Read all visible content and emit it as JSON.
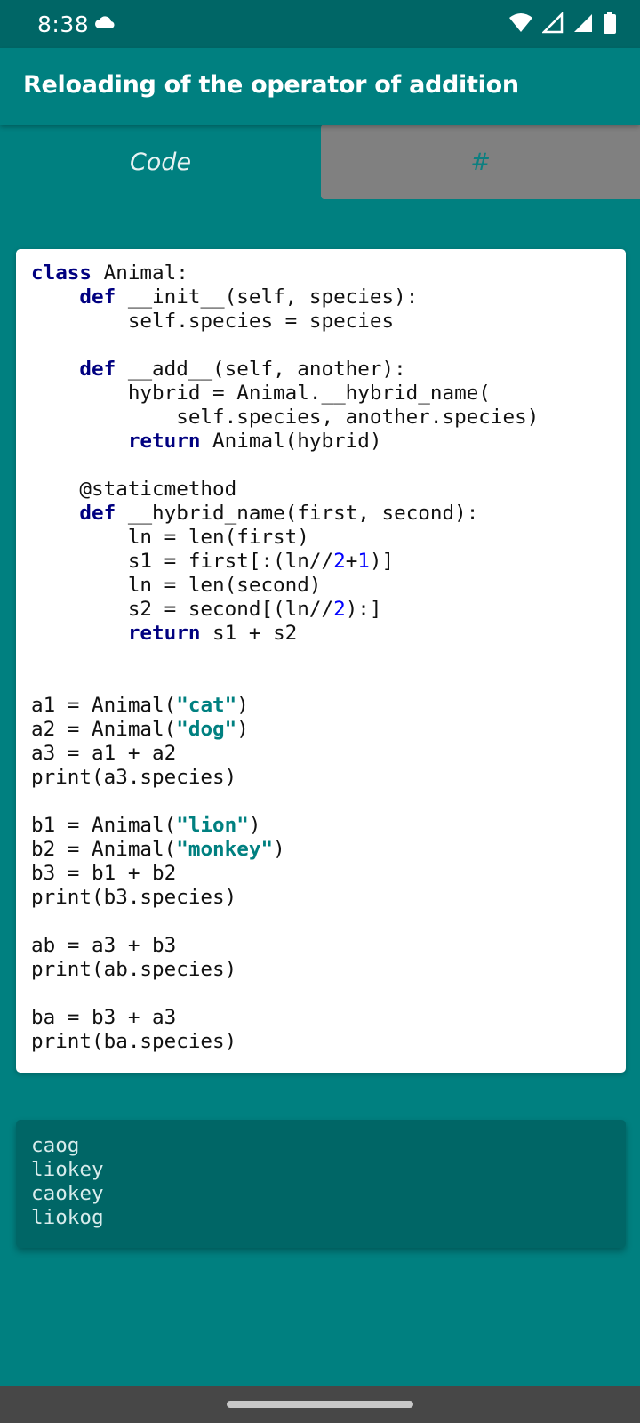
{
  "status_bar": {
    "time": "8:38",
    "icons": [
      "cloud-icon",
      "wifi-icon",
      "signal-icon",
      "signal-icon",
      "battery-icon"
    ]
  },
  "app_bar": {
    "title": "Reloading of the operator of addition"
  },
  "tabs": [
    {
      "label": "Code",
      "selected": true
    },
    {
      "label": "#",
      "selected": false
    }
  ],
  "code": {
    "lines": [
      [
        {
          "t": "class",
          "c": "kw"
        },
        {
          "t": " Animal:"
        }
      ],
      [
        {
          "t": "    "
        },
        {
          "t": "def",
          "c": "kw"
        },
        {
          "t": " __init__(self, species):"
        }
      ],
      [
        {
          "t": "        self.species = species"
        }
      ],
      [
        {
          "t": ""
        }
      ],
      [
        {
          "t": "    "
        },
        {
          "t": "def",
          "c": "kw"
        },
        {
          "t": " __add__(self, another):"
        }
      ],
      [
        {
          "t": "        hybrid = Animal.__hybrid_name("
        }
      ],
      [
        {
          "t": "            self.species, another.species)"
        }
      ],
      [
        {
          "t": "        "
        },
        {
          "t": "return",
          "c": "kw"
        },
        {
          "t": " Animal(hybrid)"
        }
      ],
      [
        {
          "t": ""
        }
      ],
      [
        {
          "t": "    @staticmethod"
        }
      ],
      [
        {
          "t": "    "
        },
        {
          "t": "def",
          "c": "kw"
        },
        {
          "t": " __hybrid_name(first, second):"
        }
      ],
      [
        {
          "t": "        ln = len(first)"
        }
      ],
      [
        {
          "t": "        s1 = first[:(ln//"
        },
        {
          "t": "2",
          "c": "num"
        },
        {
          "t": "+"
        },
        {
          "t": "1",
          "c": "num"
        },
        {
          "t": ")]"
        }
      ],
      [
        {
          "t": "        ln = len(second)"
        }
      ],
      [
        {
          "t": "        s2 = second[(ln//"
        },
        {
          "t": "2",
          "c": "num"
        },
        {
          "t": "):]"
        }
      ],
      [
        {
          "t": "        "
        },
        {
          "t": "return",
          "c": "kw"
        },
        {
          "t": " s1 + s2"
        }
      ],
      [
        {
          "t": ""
        }
      ],
      [
        {
          "t": ""
        }
      ],
      [
        {
          "t": "a1 = Animal("
        },
        {
          "t": "\"cat\"",
          "c": "str"
        },
        {
          "t": ")"
        }
      ],
      [
        {
          "t": "a2 = Animal("
        },
        {
          "t": "\"dog\"",
          "c": "str"
        },
        {
          "t": ")"
        }
      ],
      [
        {
          "t": "a3 = a1 + a2"
        }
      ],
      [
        {
          "t": "print(a3.species)"
        }
      ],
      [
        {
          "t": ""
        }
      ],
      [
        {
          "t": "b1 = Animal("
        },
        {
          "t": "\"lion\"",
          "c": "str"
        },
        {
          "t": ")"
        }
      ],
      [
        {
          "t": "b2 = Animal("
        },
        {
          "t": "\"monkey\"",
          "c": "str"
        },
        {
          "t": ")"
        }
      ],
      [
        {
          "t": "b3 = b1 + b2"
        }
      ],
      [
        {
          "t": "print(b3.species)"
        }
      ],
      [
        {
          "t": ""
        }
      ],
      [
        {
          "t": "ab = a3 + b3"
        }
      ],
      [
        {
          "t": "print(ab.species)"
        }
      ],
      [
        {
          "t": ""
        }
      ],
      [
        {
          "t": "ba = b3 + a3"
        }
      ],
      [
        {
          "t": "print(ba.species)"
        }
      ]
    ]
  },
  "output": {
    "lines": [
      "caog",
      "liokey",
      "caokey",
      "liokog"
    ]
  },
  "colors": {
    "primary": "#008080",
    "primary_dark": "#006666",
    "keyword": "#000080",
    "number": "#0000ff",
    "string": "#008080"
  }
}
